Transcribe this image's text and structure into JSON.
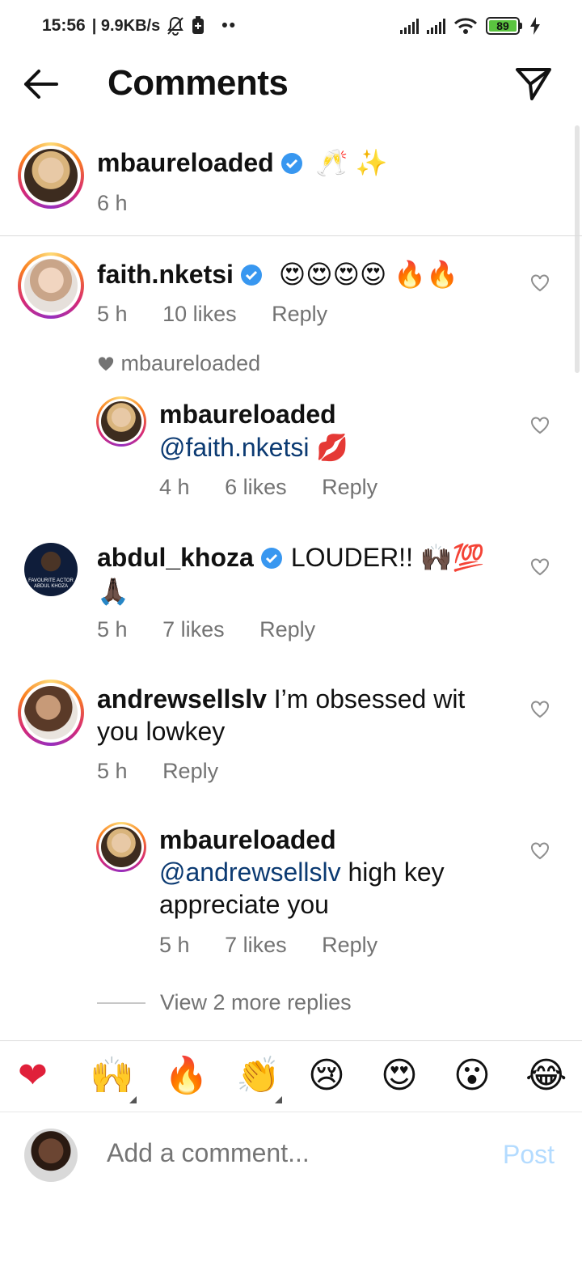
{
  "status_bar": {
    "time": "15:56",
    "net_speed": "| 9.9KB/s",
    "battery": "89"
  },
  "header": {
    "title": "Comments"
  },
  "caption": {
    "username": "mbaureloaded",
    "text": "🥂 ✨",
    "time": "6 h"
  },
  "comments": [
    {
      "username": "faith.nketsi",
      "text": "😍😍😍😍 🔥🔥",
      "time": "5 h",
      "likes": "10 likes",
      "reply": "Reply",
      "liked_by_label": "mbaureloaded",
      "reply_item": {
        "username": "mbaureloaded",
        "mention": "@faith.nketsi",
        "text": " 💋",
        "time": "4 h",
        "likes": "6 likes",
        "reply": "Reply"
      }
    },
    {
      "username": "abdul_khoza",
      "text": "LOUDER!! 🙌🏿💯",
      "text2": "🙏🏿",
      "time": "5 h",
      "likes": "7 likes",
      "reply": "Reply",
      "avatar_caption_1": "FAVOURITE ACTOR",
      "avatar_caption_2": "ABDUL KHOZA"
    },
    {
      "username": "andrewsellslv",
      "text": " I’m obsessed wit",
      "text2": "you lowkey",
      "time": "5 h",
      "reply": "Reply",
      "reply_item": {
        "username": "mbaureloaded",
        "mention": "@andrewsellslv",
        "text": " high key",
        "text2": "appreciate you",
        "time": "5 h",
        "likes": "7 likes",
        "reply": "Reply"
      },
      "view_more": "View 2 more replies"
    }
  ],
  "reactions": [
    "❤",
    "🙌",
    "🔥",
    "👏",
    "😢",
    "😍",
    "😮",
    "😂"
  ],
  "composer": {
    "placeholder": "Add a comment...",
    "post_label": "Post"
  },
  "colors": {
    "mention": "#0b3a72",
    "meta": "#737373",
    "verified": "#3897f0",
    "post": "#b3dbff"
  }
}
